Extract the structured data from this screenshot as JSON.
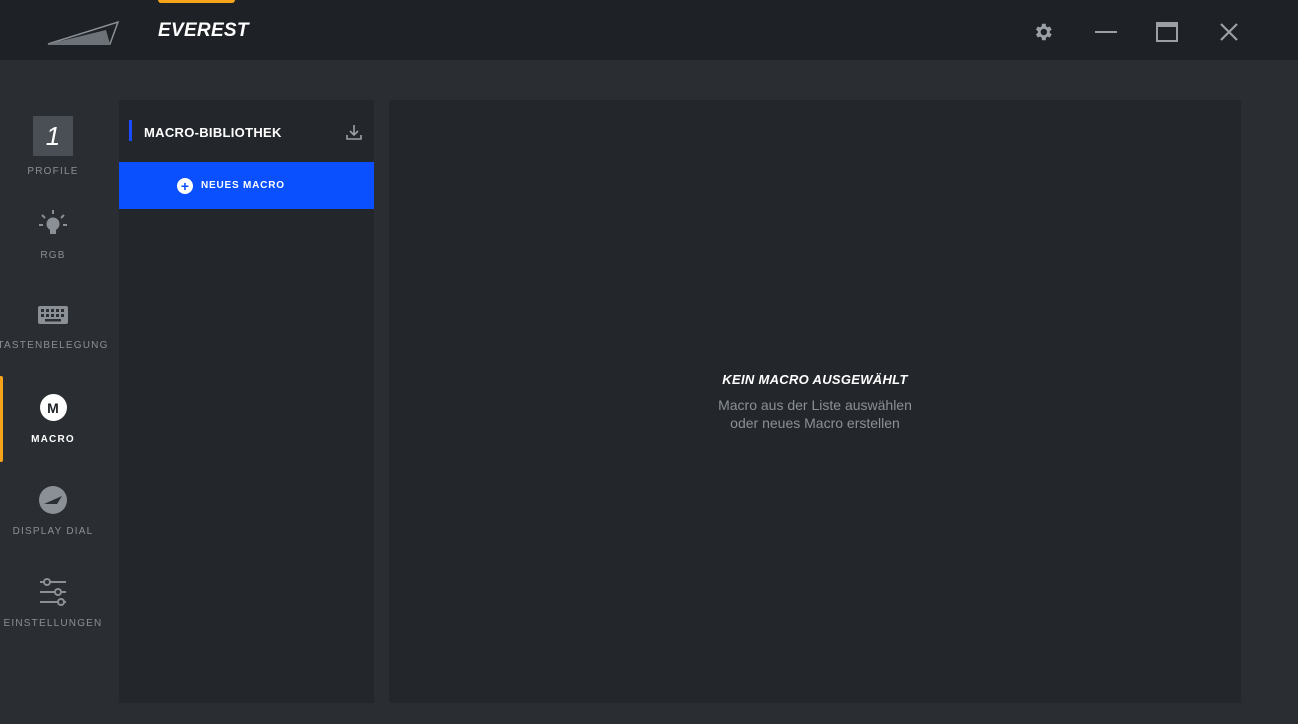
{
  "app": {
    "title": "EVEREST"
  },
  "colors": {
    "accent": "#f5a31a",
    "primary_blue": "#0a50ff",
    "bg": "#2a2e33",
    "panel": "#23272b",
    "titlebar": "#1e2125"
  },
  "window_controls": {
    "settings_icon": "gear-icon",
    "minimize_icon": "minimize-icon",
    "maximize_icon": "maximize-icon",
    "close_icon": "close-icon"
  },
  "nav": {
    "items": [
      {
        "label": "PROFILE",
        "icon": "profile-number",
        "value": "1",
        "active": false
      },
      {
        "label": "RGB",
        "icon": "bulb-icon",
        "active": false
      },
      {
        "label": "TASTENBELEGUNG",
        "icon": "keyboard-icon",
        "active": false
      },
      {
        "label": "MACRO",
        "icon": "macro-icon",
        "glyph": "M",
        "active": true
      },
      {
        "label": "DISPLAY DIAL",
        "icon": "dial-icon",
        "active": false
      },
      {
        "label": "EINSTELLUNGEN",
        "icon": "sliders-icon",
        "active": false
      }
    ]
  },
  "library": {
    "title": "MACRO-BIBLIOTHEK",
    "download_icon": "download-icon",
    "new_macro_label": "NEUES MACRO",
    "new_macro_glyph": "+"
  },
  "main": {
    "empty_heading": "KEIN MACRO AUSGEWÄHLT",
    "empty_line1": "Macro aus der Liste auswählen",
    "empty_line2": "oder neues Macro erstellen"
  }
}
